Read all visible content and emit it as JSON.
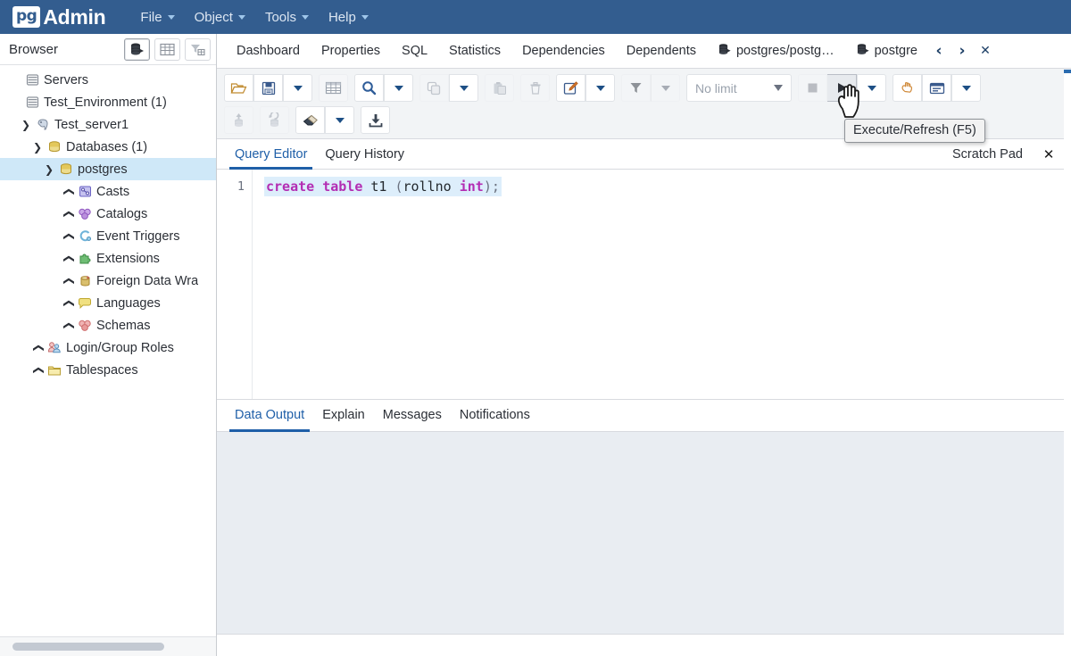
{
  "app": {
    "brand_pg": "pg",
    "brand_admin": "Admin"
  },
  "menubar": {
    "items": [
      {
        "label": "File",
        "icon": "chevron-down-icon"
      },
      {
        "label": "Object",
        "icon": "chevron-down-icon"
      },
      {
        "label": "Tools",
        "icon": "chevron-down-icon"
      },
      {
        "label": "Help",
        "icon": "chevron-down-icon"
      }
    ]
  },
  "sidebar": {
    "title": "Browser",
    "header_buttons": [
      {
        "name": "browser-view-button",
        "icon": "server-stack-icon",
        "active": true
      },
      {
        "name": "grid-view-button",
        "icon": "grid-icon",
        "active": false
      },
      {
        "name": "filter-view-button",
        "icon": "funnel-grid-icon",
        "active": false
      }
    ],
    "tree": [
      {
        "label": "Servers",
        "icon": "servers-icon",
        "indent": 0,
        "chevron": "",
        "selected": false
      },
      {
        "label": "Test_Environment (1)",
        "icon": "server-group-icon",
        "indent": 0,
        "chevron": "",
        "selected": false
      },
      {
        "label": "Test_server1",
        "icon": "postgres-elephant-icon",
        "indent": 1,
        "chevron": "down",
        "selected": false
      },
      {
        "label": "Databases (1)",
        "icon": "databases-icon",
        "indent": 2,
        "chevron": "down",
        "selected": false
      },
      {
        "label": "postgres",
        "icon": "database-icon",
        "indent": 3,
        "chevron": "down",
        "selected": true
      },
      {
        "label": "Casts",
        "icon": "casts-icon",
        "indent": 4,
        "chevron": "right",
        "selected": false
      },
      {
        "label": "Catalogs",
        "icon": "catalogs-icon",
        "indent": 4,
        "chevron": "right",
        "selected": false
      },
      {
        "label": "Event Triggers",
        "icon": "event-triggers-icon",
        "indent": 4,
        "chevron": "right",
        "selected": false
      },
      {
        "label": "Extensions",
        "icon": "extensions-icon",
        "indent": 4,
        "chevron": "right",
        "selected": false
      },
      {
        "label": "Foreign Data Wra",
        "icon": "foreign-data-wrappers-icon",
        "indent": 4,
        "chevron": "right",
        "selected": false
      },
      {
        "label": "Languages",
        "icon": "languages-icon",
        "indent": 4,
        "chevron": "right",
        "selected": false
      },
      {
        "label": "Schemas",
        "icon": "schemas-icon",
        "indent": 4,
        "chevron": "right",
        "selected": false
      },
      {
        "label": "Login/Group Roles",
        "icon": "login-roles-icon",
        "indent": 2,
        "chevron": "right",
        "selected": false
      },
      {
        "label": "Tablespaces",
        "icon": "tablespaces-icon",
        "indent": 2,
        "chevron": "right",
        "selected": false
      }
    ]
  },
  "main": {
    "tabs": [
      {
        "label": "Dashboard",
        "icon": "",
        "active": false
      },
      {
        "label": "Properties",
        "icon": "",
        "active": false
      },
      {
        "label": "SQL",
        "icon": "",
        "active": false
      },
      {
        "label": "Statistics",
        "icon": "",
        "active": false
      },
      {
        "label": "Dependencies",
        "icon": "",
        "active": false
      },
      {
        "label": "Dependents",
        "icon": "",
        "active": false
      },
      {
        "label": "postgres/postg…",
        "icon": "query-tool-icon",
        "active": false
      },
      {
        "label": "postgre",
        "icon": "query-tool-icon",
        "active": false
      }
    ],
    "tab_nav": [
      {
        "name": "tab-scroll-left-button",
        "glyph": "‹"
      },
      {
        "name": "tab-scroll-right-button",
        "glyph": "›"
      },
      {
        "name": "tab-close-button",
        "glyph": "✕"
      }
    ]
  },
  "toolbar": {
    "row1": [
      {
        "name": "open-file-button",
        "icon": "open-folder-icon",
        "style": "normal"
      },
      {
        "name": "save-file-button",
        "icon": "save-floppy-icon",
        "style": "normal"
      },
      {
        "name": "save-options-dropdown",
        "icon": "chevron-down-icon",
        "style": "caret"
      },
      {
        "name": "edit-grid-button",
        "icon": "table-grid-icon",
        "style": "flat"
      },
      {
        "name": "find-button",
        "icon": "magnifier-icon",
        "style": "normal"
      },
      {
        "name": "find-options-dropdown",
        "icon": "chevron-down-icon",
        "style": "caret"
      },
      {
        "name": "copy-button",
        "icon": "copy-icon",
        "style": "disabled"
      },
      {
        "name": "copy-options-dropdown",
        "icon": "chevron-down-icon",
        "style": "caret"
      },
      {
        "name": "paste-button",
        "icon": "paste-icon",
        "style": "disabled"
      },
      {
        "name": "delete-row-button",
        "icon": "trash-icon",
        "style": "disabled"
      },
      {
        "name": "edit-data-button",
        "icon": "edit-pencil-icon",
        "style": "normal"
      },
      {
        "name": "edit-data-dropdown",
        "icon": "chevron-down-icon",
        "style": "caret"
      },
      {
        "name": "filter-button",
        "icon": "funnel-icon",
        "style": "disabled"
      },
      {
        "name": "filter-options-dropdown",
        "icon": "chevron-down-icon",
        "style": "caret-grey"
      },
      {
        "name": "row-limit-select",
        "icon": "",
        "style": "select"
      },
      {
        "name": "stop-query-button",
        "icon": "stop-square-icon",
        "style": "disabled"
      },
      {
        "name": "execute-refresh-button",
        "icon": "play-triangle-icon",
        "style": "pressed"
      },
      {
        "name": "execute-options-dropdown",
        "icon": "chevron-down-icon",
        "style": "caret"
      },
      {
        "name": "explain-button",
        "icon": "hand-pointer-icon",
        "style": "normal"
      },
      {
        "name": "explain-analyze-button",
        "icon": "explain-panel-icon",
        "style": "normal"
      },
      {
        "name": "explain-options-dropdown",
        "icon": "chevron-down-icon",
        "style": "caret"
      }
    ],
    "row2": [
      {
        "name": "commit-button",
        "icon": "commit-icon",
        "style": "disabled"
      },
      {
        "name": "rollback-button",
        "icon": "rollback-icon",
        "style": "disabled"
      },
      {
        "name": "clear-button",
        "icon": "eraser-icon",
        "style": "normal"
      },
      {
        "name": "clear-options-dropdown",
        "icon": "chevron-down-icon",
        "style": "caret"
      },
      {
        "name": "download-csv-button",
        "icon": "download-icon",
        "style": "normal"
      }
    ],
    "row_limit_value": "No limit"
  },
  "tooltip": {
    "text": "Execute/Refresh (F5)"
  },
  "editor": {
    "tabs": [
      {
        "label": "Query Editor",
        "active": true
      },
      {
        "label": "Query History",
        "active": false
      }
    ],
    "scratch_pad_label": "Scratch Pad",
    "scratch_pad_close_glyph": "✕",
    "lines": [
      {
        "number": "1",
        "tokens": [
          {
            "text": "create",
            "kind": "keyword"
          },
          {
            "text": " ",
            "kind": "plain"
          },
          {
            "text": "table",
            "kind": "keyword"
          },
          {
            "text": " ",
            "kind": "plain"
          },
          {
            "text": "t1",
            "kind": "identifier"
          },
          {
            "text": " ",
            "kind": "plain"
          },
          {
            "text": "(",
            "kind": "punct"
          },
          {
            "text": "rollno",
            "kind": "identifier"
          },
          {
            "text": " ",
            "kind": "plain"
          },
          {
            "text": "int",
            "kind": "type"
          },
          {
            "text": ");",
            "kind": "punct"
          }
        ]
      }
    ]
  },
  "output": {
    "tabs": [
      {
        "label": "Data Output",
        "active": true
      },
      {
        "label": "Explain",
        "active": false
      },
      {
        "label": "Messages",
        "active": false
      },
      {
        "label": "Notifications",
        "active": false
      }
    ]
  },
  "colors": {
    "menubar_bg": "#335d8f",
    "accent": "#1f5fa8",
    "selection": "#cfe8f8",
    "keyword": "#b32db3",
    "code_highlight": "#ddeefb",
    "output_bg": "#e9edf2"
  }
}
